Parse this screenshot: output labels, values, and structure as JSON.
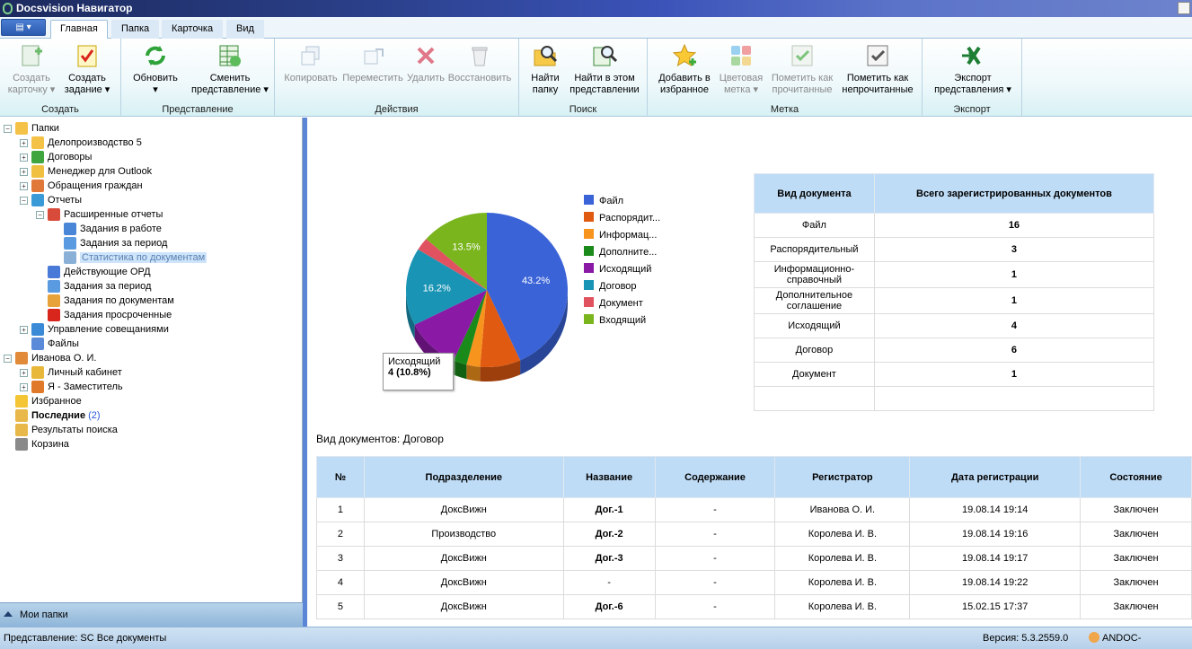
{
  "window": {
    "title": "Docsvision Навигатор"
  },
  "tabs": [
    "Главная",
    "Папка",
    "Карточка",
    "Вид"
  ],
  "ribbon": {
    "groups": [
      {
        "name": "Создать",
        "buttons": [
          {
            "label": "Создать\nкарточку ▾",
            "disabled": true
          },
          {
            "label": "Создать\nзадание ▾",
            "disabled": false
          }
        ]
      },
      {
        "name": "Представление",
        "buttons": [
          {
            "label": "Обновить\n▾",
            "disabled": false
          },
          {
            "label": "Сменить\nпредставление ▾",
            "disabled": false
          }
        ]
      },
      {
        "name": "Действия",
        "buttons": [
          {
            "label": "Копировать",
            "disabled": true
          },
          {
            "label": "Переместить",
            "disabled": true
          },
          {
            "label": "Удалить",
            "disabled": true
          },
          {
            "label": "Восстановить",
            "disabled": true
          }
        ]
      },
      {
        "name": "Поиск",
        "buttons": [
          {
            "label": "Найти\nпапку",
            "disabled": false
          },
          {
            "label": "Найти в этом\nпредставлении",
            "disabled": false
          }
        ]
      },
      {
        "name": "Метка",
        "buttons": [
          {
            "label": "Добавить в\nизбранное",
            "disabled": false
          },
          {
            "label": "Цветовая\nметка ▾",
            "disabled": true
          },
          {
            "label": "Пометить как\nпрочитанные",
            "disabled": true
          },
          {
            "label": "Пометить как\nнепрочитанные",
            "disabled": false
          }
        ]
      },
      {
        "name": "Экспорт",
        "buttons": [
          {
            "label": "Экспорт\nпредставления ▾",
            "disabled": false
          }
        ]
      }
    ]
  },
  "tree": [
    {
      "label": "Папки",
      "expander": "−",
      "icon": "folder-icon"
    },
    {
      "label": "Делопроизводство 5",
      "expander": "+",
      "icon": "folder-icon"
    },
    {
      "label": "Договоры",
      "expander": "+",
      "icon": "dollar-icon"
    },
    {
      "label": "Менеджер для Outlook",
      "expander": "+",
      "icon": "envelope-icon"
    },
    {
      "label": "Обращения граждан",
      "expander": "+",
      "icon": "people-icon"
    },
    {
      "label": "Отчеты",
      "expander": "−",
      "icon": "report-icon"
    },
    {
      "label": "Расширенные отчеты",
      "expander": "−",
      "icon": "pie-icon"
    },
    {
      "label": "Задания в работе",
      "expander": "",
      "icon": "calendar-icon"
    },
    {
      "label": "Задания за период",
      "expander": "",
      "icon": "clock-icon"
    },
    {
      "label": "Статистика по документам",
      "expander": "",
      "icon": "chart-icon"
    },
    {
      "label": "Действующие ОРД",
      "expander": "",
      "icon": "edit-icon"
    },
    {
      "label": "Задания за период",
      "expander": "",
      "icon": "clock-icon"
    },
    {
      "label": "Задания по документам",
      "expander": "",
      "icon": "document-icon"
    },
    {
      "label": "Задания просроченные",
      "expander": "",
      "icon": "alert-icon"
    },
    {
      "label": "Управление совещаниями",
      "expander": "+",
      "icon": "meeting-icon"
    },
    {
      "label": "Файлы",
      "expander": "",
      "icon": "files-icon"
    },
    {
      "label": "Иванова О. И.",
      "expander": "−",
      "icon": "user-icon"
    },
    {
      "label": "Личный кабинет",
      "expander": "+",
      "icon": "key-icon"
    },
    {
      "label": "Я - Заместитель",
      "expander": "+",
      "icon": "deputy-icon"
    },
    {
      "label": "Избранное",
      "expander": "",
      "icon": "star-icon"
    },
    {
      "label": "Последние",
      "expander": "",
      "icon": "recent-icon",
      "count": "(2)"
    },
    {
      "label": "Результаты поиска",
      "expander": "",
      "icon": "search-results-icon"
    },
    {
      "label": "Корзина",
      "expander": "",
      "icon": "trash-icon"
    }
  ],
  "sidebar_footer": "Мои папки",
  "chart_data": {
    "type": "pie",
    "categories": [
      "Файл",
      "Распорядит...",
      "Информац...",
      "Дополните...",
      "Исходящий",
      "Договор",
      "Документ",
      "Входящий"
    ],
    "values": [
      16,
      3,
      1,
      1,
      4,
      6,
      1,
      5
    ],
    "colors": [
      "#3a63d8",
      "#e05a12",
      "#f7941d",
      "#1a8a1a",
      "#8a1aa6",
      "#1a94b4",
      "#e05260",
      "#7ab51d"
    ],
    "data_labels": [
      "43.2%",
      "",
      "",
      "",
      "",
      "16.2%",
      "",
      "13.5%"
    ],
    "tooltip": {
      "title": "Исходящий",
      "value": "4 (10.8%)"
    }
  },
  "stats_table": {
    "headers": [
      "Вид документа",
      "Всего зарегистрированных документов"
    ],
    "rows": [
      [
        "Файл",
        "16"
      ],
      [
        "Распорядительный",
        "3"
      ],
      [
        "Информационно-\nсправочный",
        "1"
      ],
      [
        "Дополнительное\nсоглашение",
        "1"
      ],
      [
        "Исходящий",
        "4"
      ],
      [
        "Договор",
        "6"
      ],
      [
        "Документ",
        "1"
      ]
    ]
  },
  "caption": "Вид документов: Договор",
  "docs_table": {
    "headers": [
      "№",
      "Подразделение",
      "Название",
      "Содержание",
      "Регистратор",
      "Дата регистрации",
      "Состояние"
    ],
    "rows": [
      [
        "1",
        "ДоксВижн",
        "Дог.-1",
        "-",
        "Иванова О. И.",
        "19.08.14 19:14",
        "Заключен"
      ],
      [
        "2",
        "Производство",
        "Дог.-2",
        "-",
        "Королева И. В.",
        "19.08.14 19:16",
        "Заключен"
      ],
      [
        "3",
        "ДоксВижн",
        "Дог.-3",
        "-",
        "Королева И. В.",
        "19.08.14 19:17",
        "Заключен"
      ],
      [
        "4",
        "ДоксВижн",
        "-",
        "-",
        "Королева И. В.",
        "19.08.14 19:22",
        "Заключен"
      ],
      [
        "5",
        "ДоксВижн",
        "Дог.-6",
        "-",
        "Королева И. В.",
        "15.02.15 17:37",
        "Заключен"
      ]
    ]
  },
  "status": {
    "view": "Представление: SC Все документы",
    "version": "Версия: 5.3.2559.0",
    "user": "ANDOC-DV\\deloproi"
  }
}
